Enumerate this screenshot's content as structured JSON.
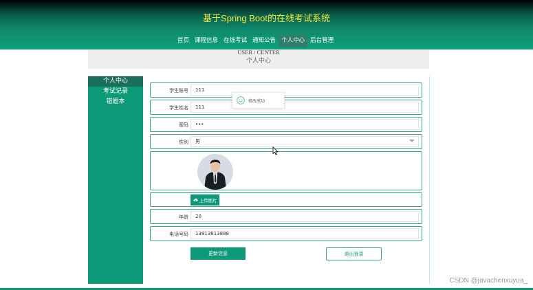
{
  "header": {
    "site_title": "基于Spring Boot的在线考试系统",
    "nav": [
      {
        "label": "首页",
        "active": false
      },
      {
        "label": "课程信息",
        "active": false
      },
      {
        "label": "在线考试",
        "active": false
      },
      {
        "label": "通知公告",
        "active": false
      },
      {
        "label": "个人中心",
        "active": true
      },
      {
        "label": "后台管理",
        "active": false
      }
    ]
  },
  "banner": {
    "title_en": "USER / CENTER",
    "title_zh": "个人中心"
  },
  "sidebar": {
    "items": [
      {
        "label": "个人中心",
        "active": true
      },
      {
        "label": "考试记录",
        "active": false
      },
      {
        "label": "错题本",
        "active": false
      }
    ]
  },
  "form": {
    "student_no": {
      "label": "学生账号",
      "value": "111"
    },
    "student_name": {
      "label": "学生姓名",
      "value": "111"
    },
    "password": {
      "label": "密码",
      "value": "•••"
    },
    "gender": {
      "label": "性别",
      "value": "男"
    },
    "avatar": {
      "icon": "user-photo"
    },
    "upload_label": "上传图片",
    "age": {
      "label": "年龄",
      "value": "20"
    },
    "phone": {
      "label": "电话号码",
      "value": "13813813888"
    }
  },
  "buttons": {
    "update": "更新信息",
    "logout": "退出登录"
  },
  "toast": {
    "text": "修改成功",
    "icon": "smile-icon"
  },
  "watermark": "CSDN @javachenxuyua_",
  "colors": {
    "primary": "#0d9978",
    "title": "#f3e73a",
    "header_dark": "#000000"
  }
}
